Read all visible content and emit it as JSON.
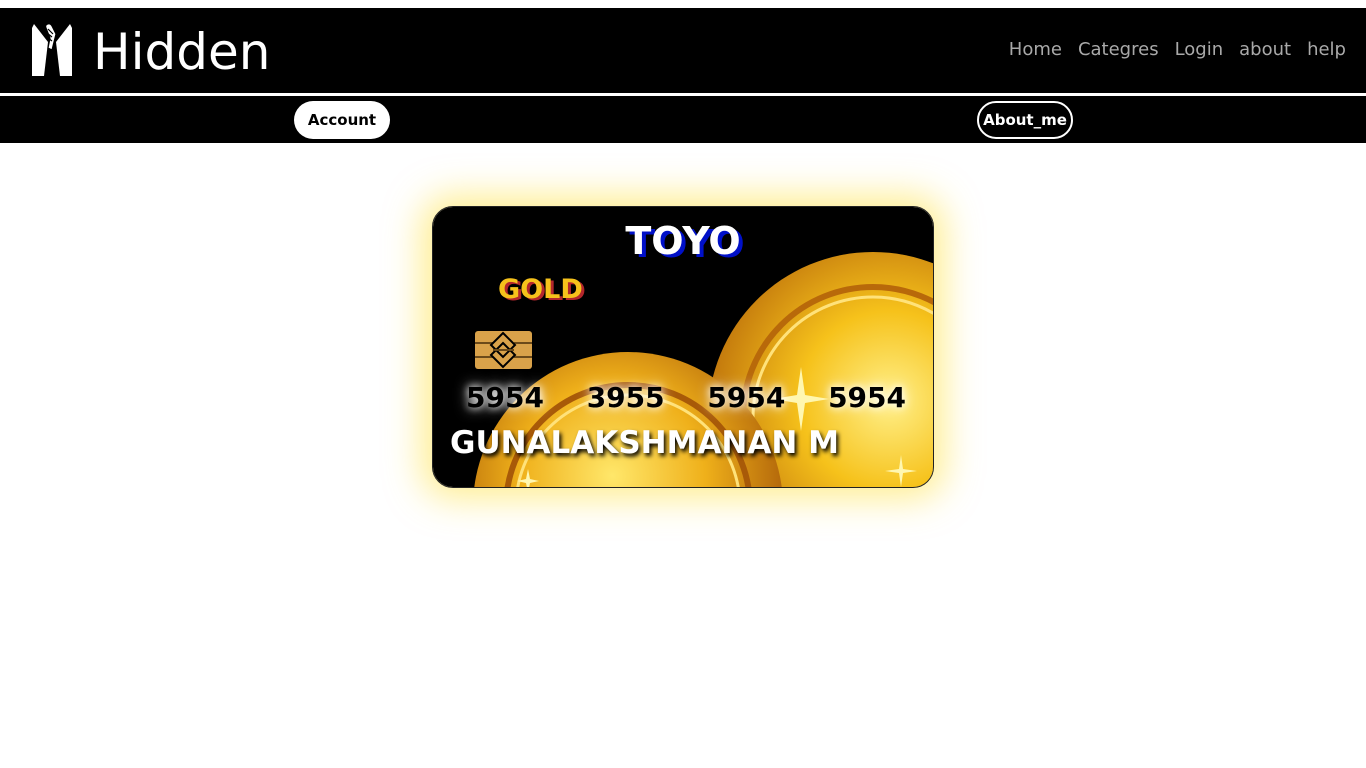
{
  "header": {
    "brand": "Hidden",
    "logo_icon": "tuxedo-hand-logo-icon",
    "nav": [
      "Home",
      "Categres",
      "Login",
      "about",
      "help"
    ]
  },
  "subnav": {
    "account_label": "Account",
    "about_label": "About_me"
  },
  "card": {
    "brand": "TOYO",
    "tier": "GOLD",
    "numbers": [
      "5954",
      "3955",
      "5954",
      "5954"
    ],
    "holder": "GUNALAKSHMANAN M",
    "chip_icon": "sim-chip-icon",
    "background_art": "gold-coins",
    "colors": {
      "brand_shadow": "#0010c8",
      "tier": "#f6c21b",
      "tier_shadow": "#b3272c",
      "glow": "#ffe03c"
    }
  }
}
